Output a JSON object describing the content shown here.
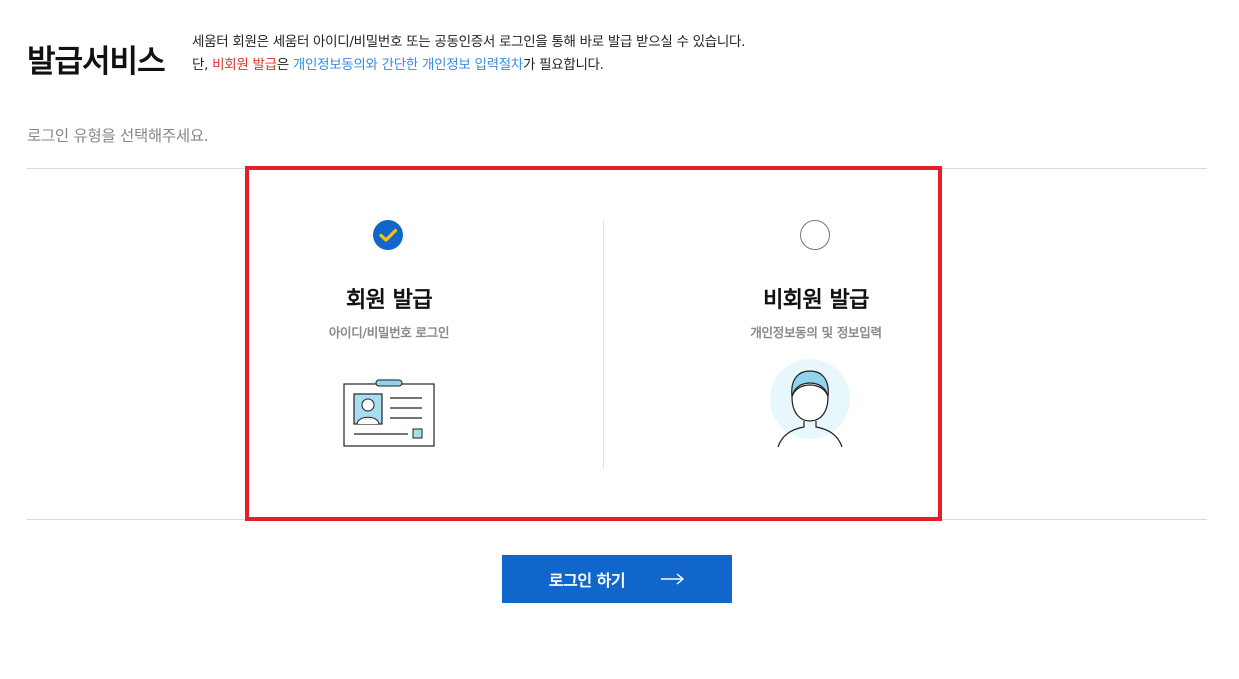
{
  "header": {
    "title": "발급서비스",
    "desc_line1": "세움터 회원은 세움터 아이디/비밀번호 또는 공동인증서 로그인을 통해 바로 발급 받으실 수 있습니다.",
    "desc_line2_prefix": "단, ",
    "desc_line2_red": "비회원 발급",
    "desc_line2_mid": "은 ",
    "desc_line2_blue": "개인정보동의와 간단한 개인정보 입력절차",
    "desc_line2_suffix": "가 필요합니다."
  },
  "prompt": "로그인 유형을 선택해주세요.",
  "options": [
    {
      "title": "회원 발급",
      "subtitle": "아이디/비밀번호 로그인",
      "selected": true,
      "icon": "id-card-icon"
    },
    {
      "title": "비회원 발급",
      "subtitle": "개인정보동의 및 정보입력",
      "selected": false,
      "icon": "person-icon"
    }
  ],
  "login_button": {
    "label": "로그인 하기",
    "arrow": "⟶"
  },
  "colors": {
    "accent": "#1166cc",
    "highlight_border": "#e3202a",
    "red_text": "#e0342c",
    "blue_text": "#3a8be0",
    "check": "#f5c400",
    "illus_bg": "#e8f7fb"
  }
}
